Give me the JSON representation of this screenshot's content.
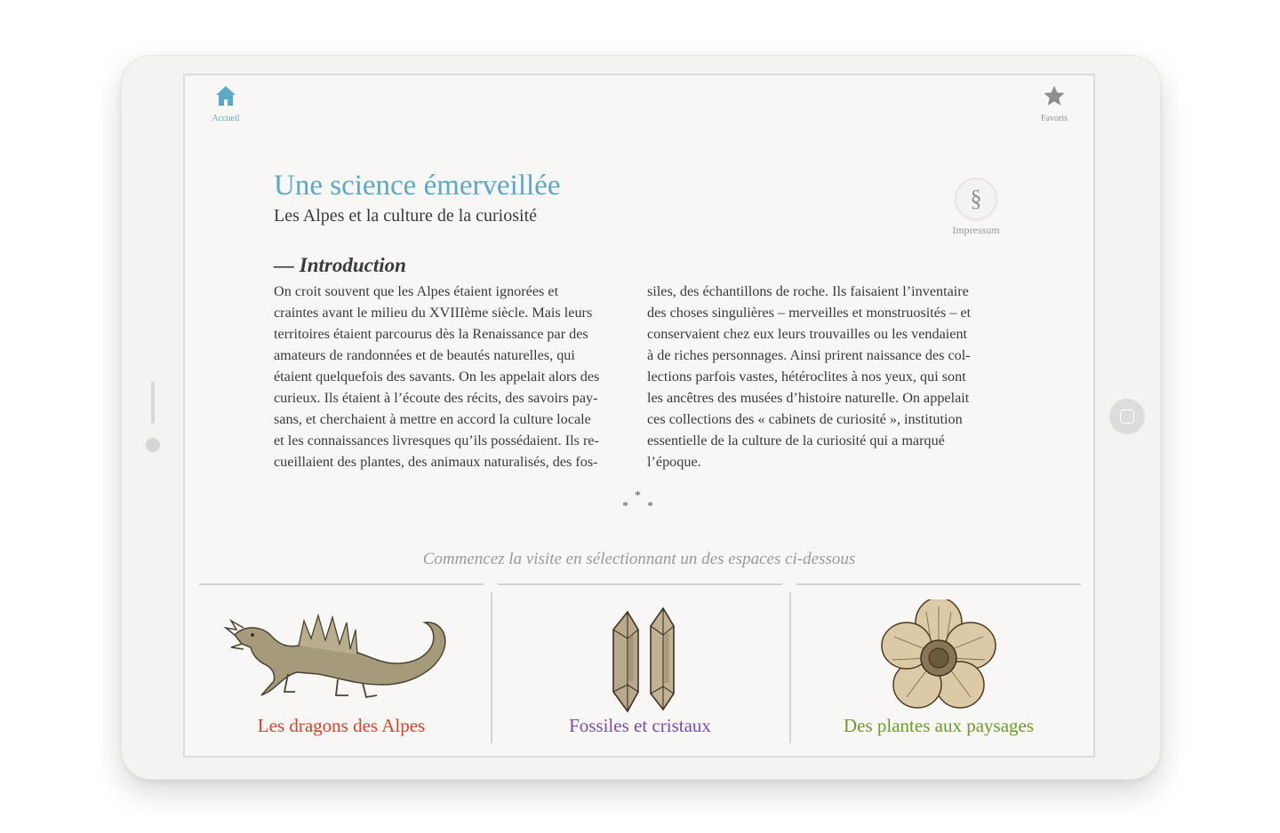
{
  "nav": {
    "home_label": "Accueil",
    "favorites_label": "Favoris"
  },
  "header": {
    "title": "Une science émerveillée",
    "subtitle": "Les Alpes et la culture de la curiosité"
  },
  "impressum": {
    "symbol": "§",
    "label": "Impressum"
  },
  "intro": {
    "heading": "— Introduction",
    "column1": [
      "On croit souvent que les Alpes étaient ignorées et",
      "craintes avant le milieu du XVIIIème siècle. Mais leurs",
      "territoires étaient parcourus dès la Renaissance par des",
      "amateurs de randonnées et de beautés naturelles, qui",
      "étaient quelquefois des savants. On les appelait alors des",
      "curieux. Ils étaient à l’écoute des récits, des savoirs pay-",
      "sans, et cherchaient à mettre en accord la culture locale",
      "et les connaissances livresques qu’ils possédaient. Ils re-",
      "cueillaient des plantes, des animaux naturalisés, des fos-"
    ],
    "column2": [
      "siles, des échantillons de roche. Ils faisaient l’inventaire",
      "des choses singulières – merveilles et monstruosités – et",
      "conservaient chez eux leurs trouvailles ou les vendaient",
      "à de riches personnages. Ainsi prirent naissance des col-",
      "lections parfois vastes, hétéroclites à nos yeux, qui sont",
      "les ancêtres des musées d’histoire naturelle. On appelait",
      "ces collections des « cabinets de curiosité », institution",
      "essentielle de la culture de la curiosité qui a marqué",
      "l’époque."
    ]
  },
  "cta_text": "Commencez la visite en sélectionnant un des espaces ci-dessous",
  "sections": [
    {
      "label": "Les dragons des Alpes",
      "color": "#d9412b",
      "icon": "dragon-illustration"
    },
    {
      "label": "Fossiles et cristaux",
      "color": "#7b4cb0",
      "icon": "crystals-illustration"
    },
    {
      "label": "Des plantes aux paysages",
      "color": "#6e9a2e",
      "icon": "flower-illustration"
    }
  ],
  "colors": {
    "accent": "#5aa9c8",
    "text": "#3a3a3a",
    "muted": "#999999"
  }
}
